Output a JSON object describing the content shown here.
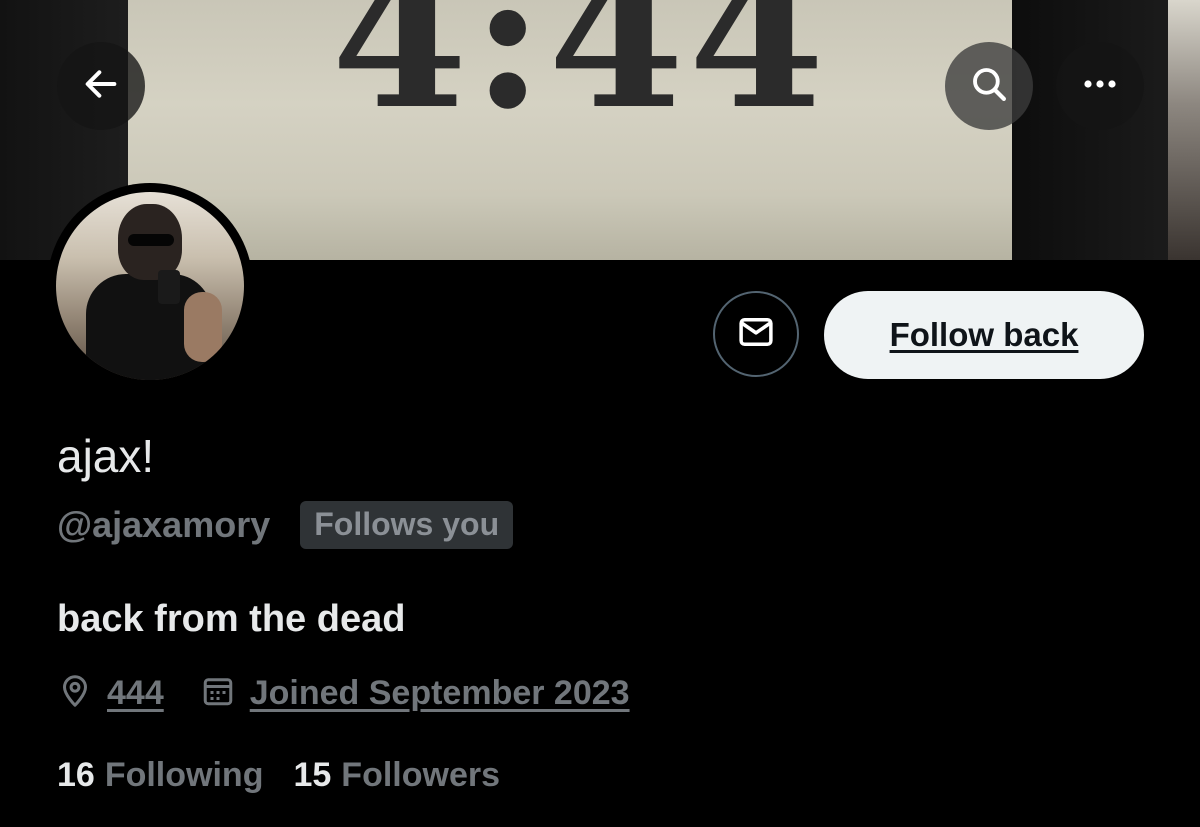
{
  "banner": {
    "text": "4:44"
  },
  "navigation": {
    "back_icon": "arrow-left-icon",
    "search_icon": "search-icon",
    "more_icon": "more-horizontal-icon"
  },
  "actions": {
    "message_icon": "envelope-icon",
    "follow_back_label": "Follow back"
  },
  "profile": {
    "display_name": "ajax!",
    "handle": "@ajaxamory",
    "follows_you_badge": "Follows you",
    "bio": "back from the dead",
    "location": "444",
    "joined": "Joined September 2023",
    "following_count": "16",
    "following_label": "Following",
    "followers_count": "15",
    "followers_label": "Followers"
  },
  "colors": {
    "background": "#000000",
    "primary_text": "#e7e9ea",
    "secondary_text": "#71767b",
    "follow_button_bg": "#eff3f4",
    "badge_bg": "#2f3336"
  }
}
